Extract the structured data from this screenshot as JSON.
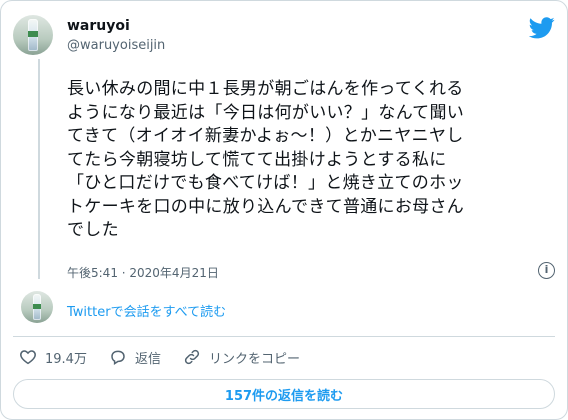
{
  "user": {
    "display_name": "waruyoi",
    "handle": "@waruyoiseijin"
  },
  "tweet": {
    "text": "長い休みの間に中１長男が朝ごはんを作ってくれる\nようになり最近は「今日は何がいい？」なんて聞い\nてきて（オイオイ新妻かよぉ～！）とかニヤニヤし\nてたら今朝寝坊して慌てて出掛けようとする私に\n「ひと口だけでも食べてけば！」と焼き立てのホッ\nトケーキを口の中に放り込んできて普通にお母さん\nでした",
    "timestamp": "午後5:41 · 2020年4月21日"
  },
  "thread": {
    "read_conversation": "Twitterで会話をすべて読む"
  },
  "actions": {
    "likes": "19.4万",
    "reply_label": "返信",
    "copy_link_label": "リンクをコピー"
  },
  "replies_button": "157件の返信を読む",
  "colors": {
    "accent": "#1d9bf0",
    "like": "#f91880",
    "muted": "#536471",
    "border": "#cfd9de"
  },
  "icons": [
    "twitter-bird-icon",
    "info-icon",
    "heart-icon",
    "reply-icon",
    "link-icon"
  ]
}
